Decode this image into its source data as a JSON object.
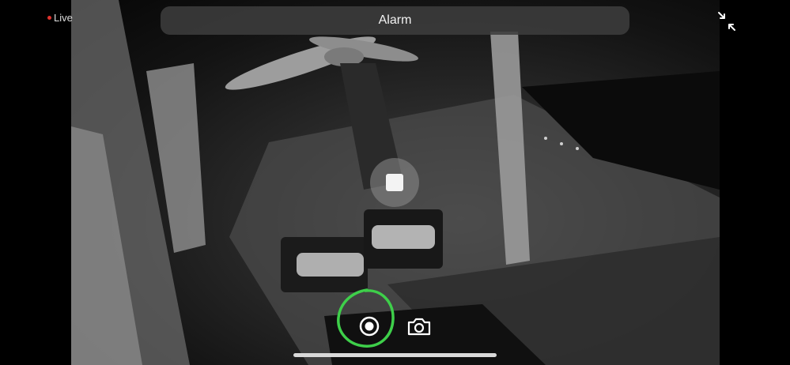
{
  "status": {
    "live_label": "Live",
    "live_color": "#e0332d"
  },
  "header": {
    "title": "Alarm"
  },
  "icons": {
    "minimize": "minimize-arrows-icon",
    "stop": "stop-square-icon",
    "record": "record-icon",
    "snapshot": "camera-icon"
  },
  "annotation": {
    "color": "#3ecf4a",
    "shape": "hand-drawn circle around record button"
  }
}
